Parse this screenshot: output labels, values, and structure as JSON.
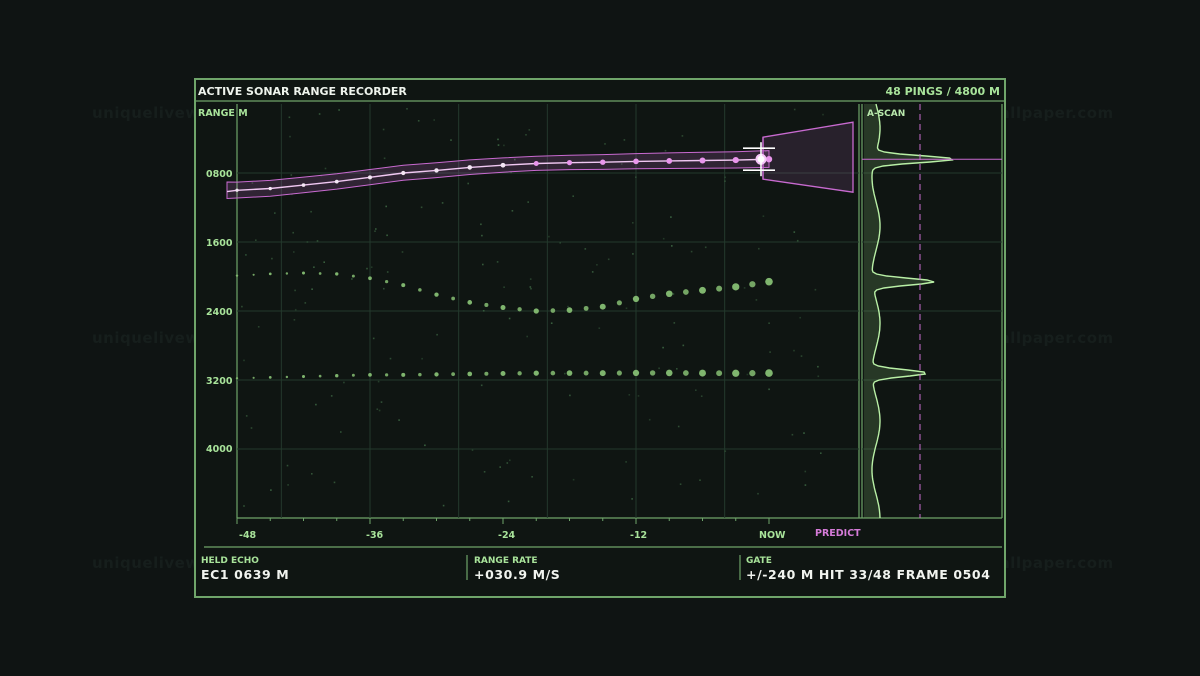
{
  "header": {
    "title": "ACTIVE SONAR RANGE RECORDER",
    "status": "48 PINGS / 4800 M"
  },
  "axes": {
    "y_title": "RANGE M",
    "y_ticks": [
      "0800",
      "1600",
      "2400",
      "3200",
      "4000"
    ],
    "x_ticks": [
      "-48",
      "-36",
      "-24",
      "-12",
      "NOW"
    ],
    "predict_label": "PREDICT"
  },
  "ascan": {
    "label": "A-SCAN"
  },
  "footer": {
    "held_echo": {
      "label": "HELD ECHO",
      "value": "EC1  0639 M"
    },
    "range_rate": {
      "label": "RANGE RATE",
      "value": "+030.9 M/S"
    },
    "gate": {
      "label": "GATE",
      "value": "+/-240 M  HIT 33/48  FRAME 0504"
    }
  },
  "watermark": "uniquelivewallpaper.com",
  "colors": {
    "frame": "#6fa56a",
    "grid": "#23392c",
    "echo_green": "#7fb56e",
    "tracked_magenta": "#c86ad0",
    "text_green": "#a8e39a"
  },
  "chart_data": {
    "type": "scatter",
    "x_range": [
      -48,
      0
    ],
    "y_range": [
      0,
      4800
    ],
    "y_reversed": true,
    "series": [
      {
        "x": [
          -48,
          -45,
          -42,
          -39,
          -36,
          -33,
          -30,
          -27,
          -24,
          -21,
          -18,
          -15,
          -12,
          -9,
          -6,
          -3,
          0
        ],
        "y": [
          1000,
          980,
          940,
          900,
          850,
          800,
          770,
          735,
          710,
          690,
          680,
          675,
          665,
          660,
          655,
          650,
          640
        ]
      },
      {
        "x": [
          -48,
          -45,
          -42,
          -39,
          -36,
          -33,
          -30,
          -27,
          -24,
          -21,
          -18,
          -15,
          -12,
          -9,
          -6,
          -3,
          0
        ],
        "y": [
          1990,
          1970,
          1960,
          1970,
          2020,
          2100,
          2210,
          2300,
          2360,
          2400,
          2390,
          2350,
          2260,
          2200,
          2160,
          2120,
          2060
        ]
      },
      {
        "x": [
          -48,
          -45,
          -42,
          -39,
          -36,
          -33,
          -30,
          -27,
          -24,
          -21,
          -18,
          -15,
          -12,
          -9,
          -6,
          -3,
          0
        ],
        "y": [
          3180,
          3170,
          3160,
          3150,
          3140,
          3140,
          3135,
          3130,
          3125,
          3120,
          3120,
          3120,
          3118,
          3118,
          3120,
          3122,
          3120
        ]
      }
    ],
    "ascan_peaks_m": [
      640,
      2060,
      3120
    ]
  }
}
